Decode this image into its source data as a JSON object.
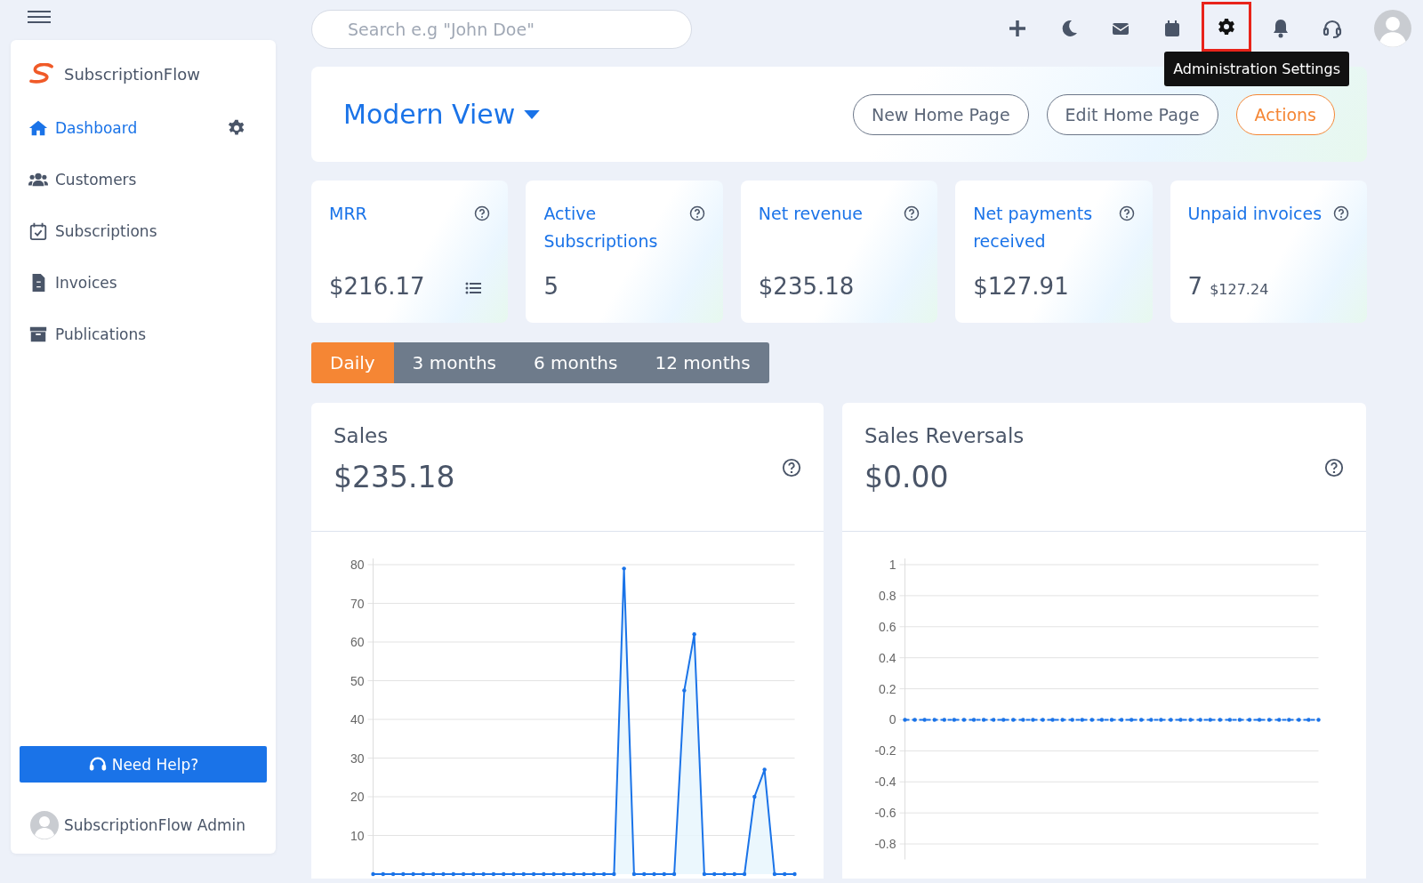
{
  "sidebar": {
    "brand": "SubscriptionFlow",
    "items": [
      {
        "kind": "home",
        "label": "Dashboard",
        "selected": true
      },
      {
        "kind": "users",
        "label": "Customers",
        "selected": false
      },
      {
        "kind": "calendar",
        "label": "Subscriptions",
        "selected": false
      },
      {
        "kind": "invoice",
        "label": "Invoices",
        "selected": false
      },
      {
        "kind": "archive",
        "label": "Publications",
        "selected": false
      }
    ],
    "help_button": "Need Help?",
    "user": "SubscriptionFlow Admin"
  },
  "search": {
    "placeholder": "Search e.g \"John Doe\""
  },
  "toolbar_icons": [
    {
      "kind": "plus",
      "highlighted": false
    },
    {
      "kind": "moon",
      "highlighted": false
    },
    {
      "kind": "mail",
      "highlighted": false
    },
    {
      "kind": "calendar",
      "highlighted": false
    },
    {
      "kind": "gear",
      "highlighted": true
    },
    {
      "kind": "bell",
      "highlighted": false
    },
    {
      "kind": "headset",
      "highlighted": false
    }
  ],
  "tooltip": "Administration Settings",
  "header": {
    "view": "Modern View",
    "buttons": [
      {
        "label": "New Home Page",
        "kind": "outline"
      },
      {
        "label": "Edit Home Page",
        "kind": "outline"
      },
      {
        "label": "Actions",
        "kind": "accent"
      }
    ]
  },
  "stats": [
    {
      "title": "MRR",
      "value": "$216.17",
      "list_icon": true
    },
    {
      "title": "Active Subscriptions",
      "value": "5"
    },
    {
      "title": "Net revenue",
      "value": "$235.18"
    },
    {
      "title": "Net payments received",
      "value": "$127.91"
    },
    {
      "title": "Unpaid invoices",
      "value": "7",
      "sub": "$127.24"
    }
  ],
  "periods": [
    {
      "label": "Daily",
      "selected": true
    },
    {
      "label": "3 months",
      "selected": false
    },
    {
      "label": "6 months",
      "selected": false
    },
    {
      "label": "12 months",
      "selected": false
    }
  ],
  "charts": [
    {
      "title": "Sales",
      "total": "$235.18",
      "chart_data": {
        "type": "area",
        "grid": true,
        "ylim": [
          0,
          80
        ],
        "yticks": [
          10,
          20,
          30,
          40,
          50,
          60,
          70,
          80
        ],
        "values": [
          0,
          0,
          0,
          0,
          0,
          0,
          0,
          0,
          0,
          0,
          0,
          0,
          0,
          0,
          0,
          0,
          0,
          0,
          0,
          0,
          0,
          0,
          0,
          0,
          0,
          79,
          0,
          0,
          0,
          0,
          0,
          47.5,
          62,
          0,
          0,
          0,
          0,
          0,
          20,
          27,
          0,
          0,
          0
        ]
      }
    },
    {
      "title": "Sales Reversals",
      "total": "$0.00",
      "chart_data": {
        "type": "line",
        "grid": true,
        "line_style": "dashed",
        "ylim": [
          -0.9,
          1
        ],
        "yticks": [
          1,
          0.8,
          0.6,
          0.4,
          0.2,
          0,
          -0.2,
          -0.4,
          -0.6,
          -0.8
        ],
        "values": [
          0,
          0,
          0,
          0,
          0,
          0,
          0,
          0,
          0,
          0,
          0,
          0,
          0,
          0,
          0,
          0,
          0,
          0,
          0,
          0,
          0,
          0,
          0,
          0,
          0,
          0,
          0,
          0,
          0,
          0,
          0,
          0,
          0,
          0,
          0,
          0,
          0,
          0,
          0,
          0,
          0,
          0,
          0
        ]
      }
    }
  ]
}
